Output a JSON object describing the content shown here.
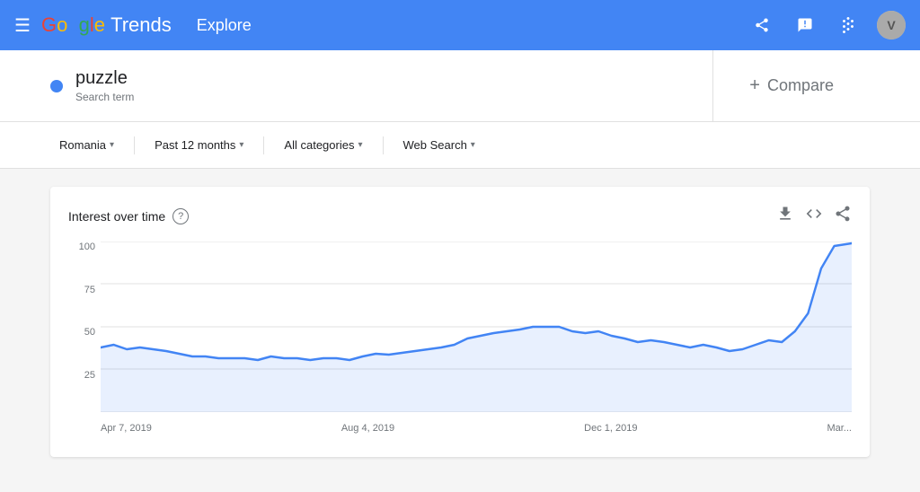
{
  "header": {
    "logo_google": "Google",
    "logo_trends": "Trends",
    "explore_label": "Explore",
    "share_icon": "share",
    "message_icon": "message",
    "apps_icon": "apps",
    "avatar_letter": "V"
  },
  "search": {
    "term": "puzzle",
    "term_type": "Search term",
    "compare_label": "Compare"
  },
  "filters": {
    "region": "Romania",
    "time_period": "Past 12 months",
    "categories": "All categories",
    "search_type": "Web Search"
  },
  "chart": {
    "title": "Interest over time",
    "help_icon": "?",
    "download_icon": "↓",
    "embed_icon": "<>",
    "share_icon": "share",
    "y_labels": [
      "100",
      "75",
      "50",
      "25"
    ],
    "x_labels": [
      "Apr 7, 2019",
      "Aug 4, 2019",
      "Dec 1, 2019",
      "Mar..."
    ],
    "line_color": "#4285f4",
    "grid_color": "#e0e0e0"
  }
}
